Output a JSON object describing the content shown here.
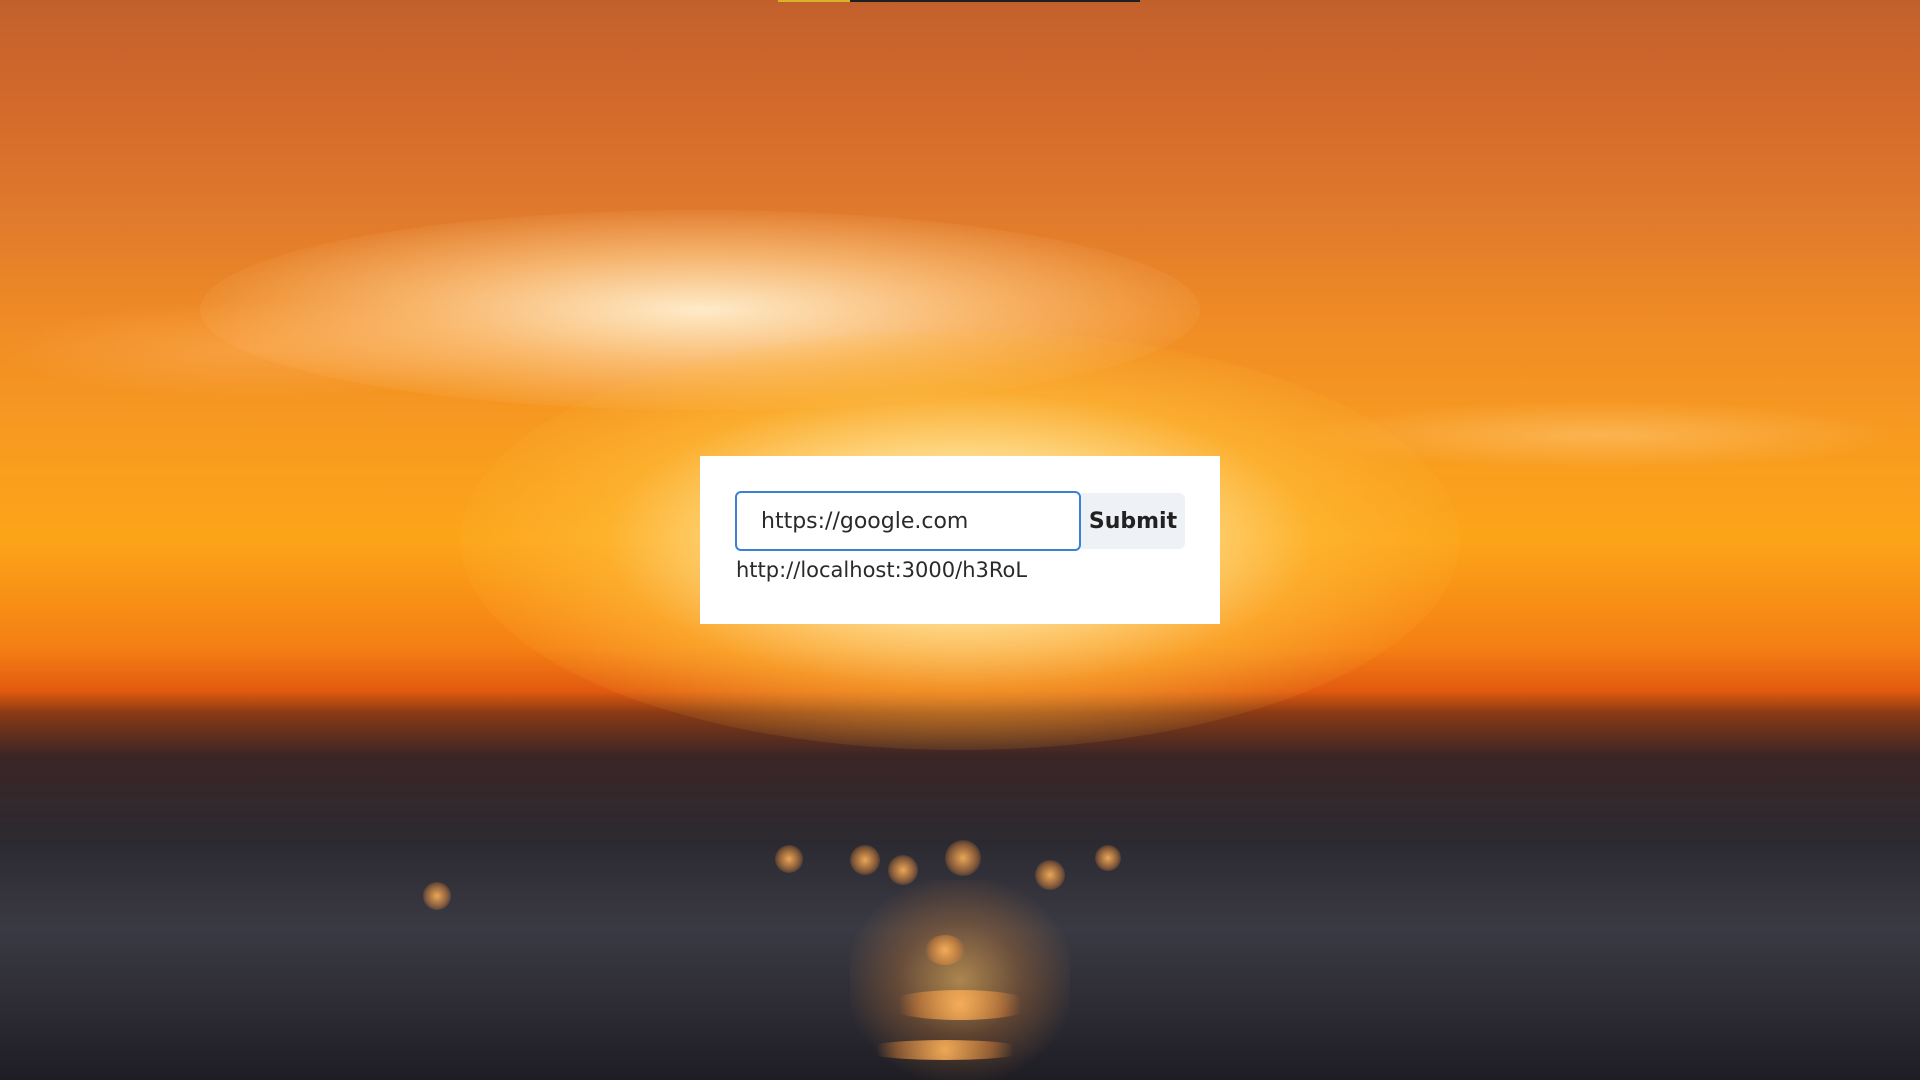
{
  "form": {
    "url_value": "https://google.com",
    "submit_label": "Submit",
    "short_url": "http://localhost:3000/h3RoL"
  },
  "colors": {
    "input_border": "#3d7fd1",
    "button_bg": "#eef1f5",
    "card_bg": "#ffffff"
  }
}
